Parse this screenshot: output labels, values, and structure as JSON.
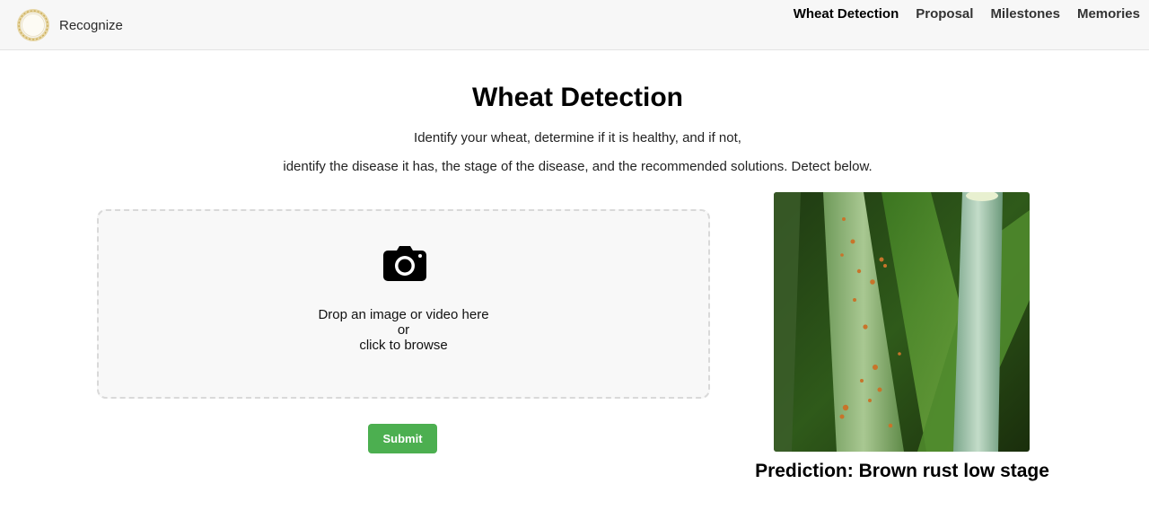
{
  "navbar": {
    "brand_name": "Recognize",
    "brand_logo_icon": "wheat-wreath-logo",
    "links": [
      {
        "label": "Wheat Detection",
        "active": true
      },
      {
        "label": "Proposal",
        "active": false
      },
      {
        "label": "Milestones",
        "active": false
      },
      {
        "label": "Memories",
        "active": false
      }
    ]
  },
  "main": {
    "title": "Wheat Detection",
    "description_line1": "Identify your wheat, determine if it is healthy, and if not,",
    "description_line2": "identify the disease it has, the stage of the disease, and the recommended solutions. Detect below."
  },
  "upload": {
    "icon": "camera-icon",
    "line1": "Drop an image or video here",
    "line2": "or",
    "line3": "click to browse",
    "submit_label": "Submit",
    "submit_color": "#4caf50"
  },
  "result": {
    "prediction_text": "Prediction: Brown rust low stage"
  }
}
